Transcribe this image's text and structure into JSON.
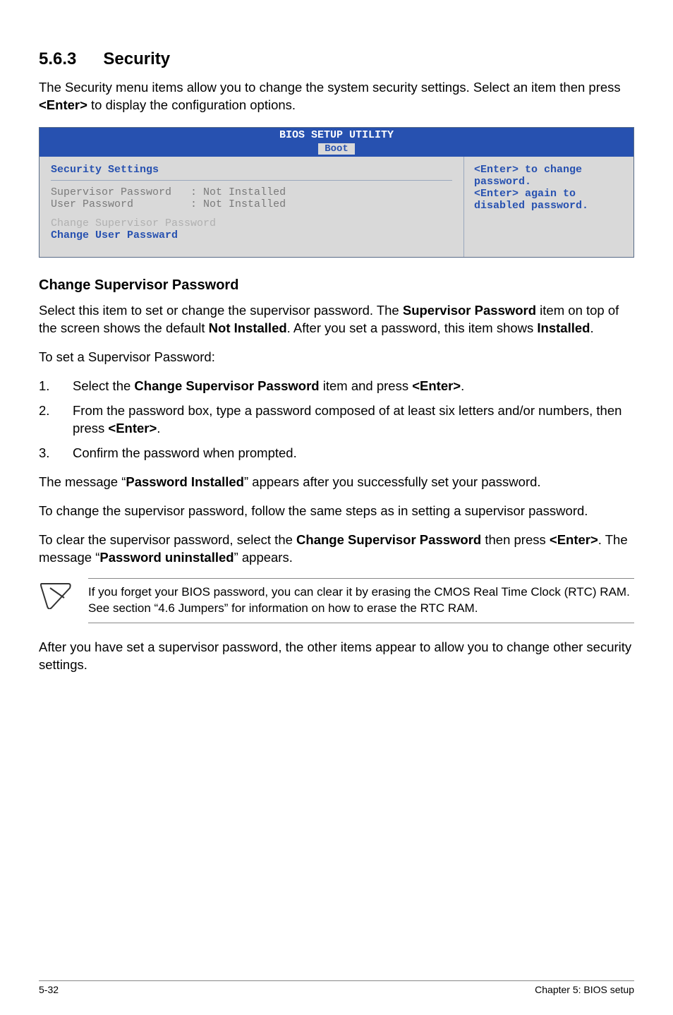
{
  "section": {
    "number": "5.6.3",
    "title": "Security",
    "intro_pre": "The Security menu items allow you to change the system security settings. Select an item then press ",
    "intro_key": "<Enter>",
    "intro_post": " to display the configuration options."
  },
  "bios": {
    "title": "BIOS SETUP UTILITY",
    "tab": "Boot",
    "section_title": "Security Settings",
    "rows": [
      {
        "label": "Supervisor Password",
        "value": ": Not Installed"
      },
      {
        "label": "User Password",
        "value": ": Not Installed"
      }
    ],
    "change_supervisor": "Change Supervisor Password",
    "change_user": "Change User Passward",
    "help_lines": [
      "<Enter> to change",
      "password.",
      "<Enter> again to",
      "disabled password."
    ]
  },
  "csp": {
    "heading": "Change Supervisor Password",
    "para1_parts": [
      "Select this item to set or change the supervisor password. The ",
      "Supervisor Password",
      " item on top of the screen shows the default ",
      "Not Installed",
      ". After you set a password, this item shows ",
      "Installed",
      "."
    ],
    "para2": "To set a Supervisor Password:",
    "steps": [
      {
        "pre": "Select the ",
        "b1": "Change Supervisor Password",
        "mid": " item and press ",
        "b2": "<Enter>",
        "post": "."
      },
      {
        "pre": "From the password box, type a password composed of at least six letters and/or numbers, then press ",
        "b1": "<Enter>",
        "mid": "",
        "b2": "",
        "post": "."
      },
      {
        "pre": "Confirm the password when prompted.",
        "b1": "",
        "mid": "",
        "b2": "",
        "post": ""
      }
    ],
    "msg1_pre": "The message “",
    "msg1_b": "Password Installed",
    "msg1_post": "” appears after you successfully set your password.",
    "para4": "To change the supervisor password, follow the same steps as in setting a supervisor password.",
    "para5_pre": "To clear the supervisor password, select the ",
    "para5_b1": "Change Supervisor Password",
    "para5_mid": " then press ",
    "para5_b2": "<Enter>",
    "para5_mid2": ". The message “",
    "para5_b3": "Password uninstalled",
    "para5_post": "” appears.",
    "note": "If you forget your BIOS password, you can clear it by erasing the CMOS Real Time Clock (RTC) RAM. See section “4.6 Jumpers” for information on how to erase the RTC RAM.",
    "para6": "After you have set a supervisor password, the other items appear to allow you to change other security settings."
  },
  "footer": {
    "left": "5-32",
    "right": "Chapter 5: BIOS setup"
  }
}
